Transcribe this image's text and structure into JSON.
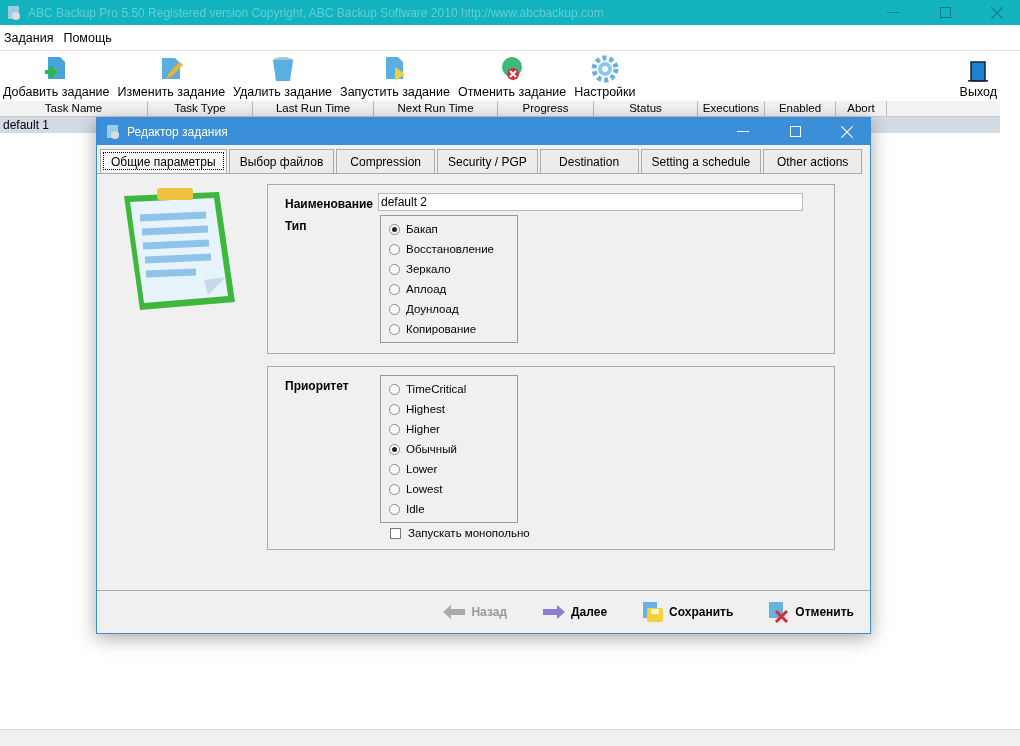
{
  "window": {
    "title": "ABC Backup Pro 5.50   Registered version   Copyright,  ABC Backup Software 2010    http://www.abcbackup.com"
  },
  "menu": [
    "Задания",
    "Помощь"
  ],
  "toolbar": [
    {
      "kind": "add",
      "label": "Добавить задание"
    },
    {
      "kind": "edit",
      "label": "Изменить задание"
    },
    {
      "kind": "delete",
      "label": "Удалить задание"
    },
    {
      "kind": "run",
      "label": "Запустить задание"
    },
    {
      "kind": "cancel",
      "label": "Отменить задание"
    },
    {
      "kind": "settings",
      "label": "Настройки"
    },
    {
      "kind": "exit",
      "label": "Выход"
    }
  ],
  "table": {
    "columns": [
      "Task Name",
      "Task Type",
      "Last Run Time",
      "Next Run Time",
      "Progress",
      "Status",
      "Executions",
      "Enabled",
      "Abort"
    ],
    "rows": [
      {
        "task_name": "default 1",
        "selected": true
      }
    ]
  },
  "dialog": {
    "title": "Редактор задания",
    "tabs": [
      {
        "label": "Общие параметры",
        "selected": true
      },
      {
        "label": "Выбор файлов",
        "selected": false
      },
      {
        "label": "Compression",
        "selected": false
      },
      {
        "label": "Security / PGP",
        "selected": false
      },
      {
        "label": "Destination",
        "selected": false
      },
      {
        "label": "Setting a schedule",
        "selected": false
      },
      {
        "label": "Other actions",
        "selected": false
      }
    ],
    "name_label": "Наименование",
    "name_value": "default 2",
    "type_label": "Тип",
    "types": [
      {
        "label": "Бакап",
        "selected": true
      },
      {
        "label": "Восстановление",
        "selected": false
      },
      {
        "label": "Зеркало",
        "selected": false
      },
      {
        "label": "Аплоад",
        "selected": false
      },
      {
        "label": "Доунлоад",
        "selected": false
      },
      {
        "label": "Копирование",
        "selected": false
      }
    ],
    "priority_label": "Приоритет",
    "priorities": [
      {
        "label": "TimeCritical",
        "selected": false
      },
      {
        "label": "Highest",
        "selected": false
      },
      {
        "label": "Higher",
        "selected": false
      },
      {
        "label": "Обычный",
        "selected": true
      },
      {
        "label": "Lower",
        "selected": false
      },
      {
        "label": "Lowest",
        "selected": false
      },
      {
        "label": "Idle",
        "selected": false
      }
    ],
    "exclusive": {
      "label": "Запускать монопольно",
      "checked": false
    },
    "buttons": [
      {
        "kind": "back",
        "label": "Назад",
        "disabled": true
      },
      {
        "kind": "next",
        "label": "Далее",
        "disabled": false
      },
      {
        "kind": "save",
        "label": "Сохранить",
        "disabled": false
      },
      {
        "kind": "cancel",
        "label": "Отменить",
        "disabled": false
      }
    ]
  }
}
